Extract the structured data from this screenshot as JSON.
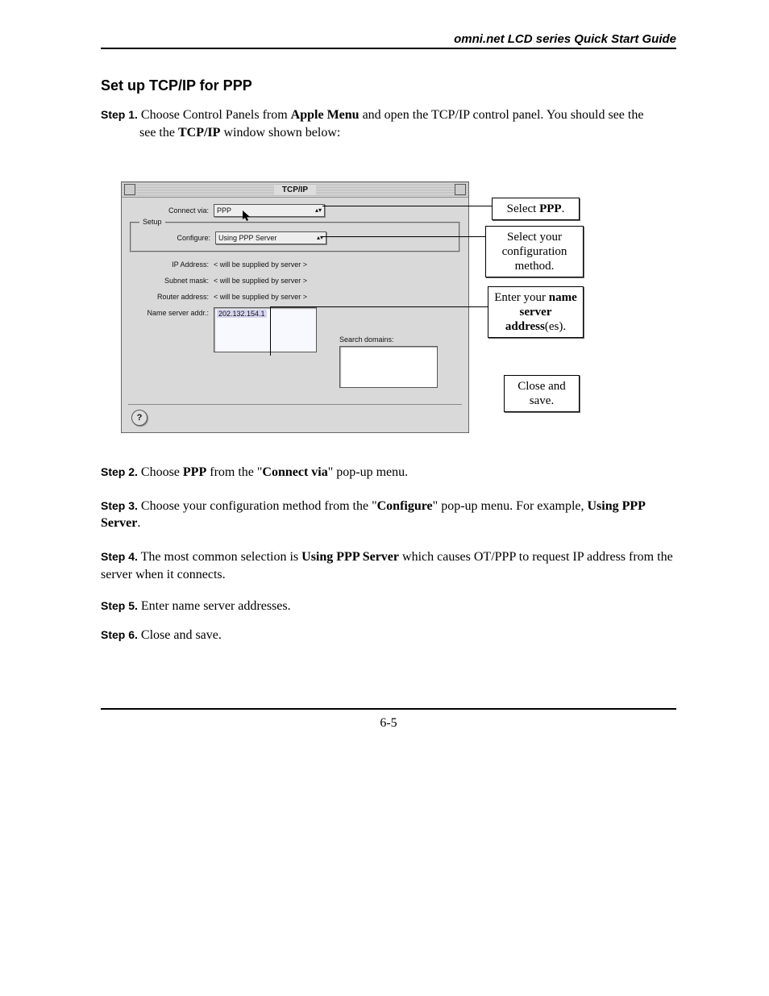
{
  "header": "omni.net LCD series Quick Start Guide",
  "section_title": "Set up TCP/IP for PPP",
  "steps": {
    "s1": {
      "label": "Step 1.",
      "pre": " Choose Control Panels from ",
      "b1": "Apple Menu",
      "mid": " and open the TCP/IP control panel. You should see the ",
      "b2": "TCP/IP",
      "post": " window shown below:"
    },
    "s2": {
      "label": "Step 2.",
      "pre": " Choose ",
      "b1": "PPP",
      "mid": " from the \"",
      "b2": "Connect via",
      "post": "\" pop-up menu."
    },
    "s3": {
      "label": "Step 3.",
      "pre": " Choose your configuration method from the \"",
      "b1": "Configure",
      "mid": "\" pop-up menu. For example, ",
      "b2": "Using PPP Server",
      "post": "."
    },
    "s4": {
      "label": "Step 4.",
      "pre": " The most common selection is ",
      "b1": "Using PPP Server",
      "post": " which causes OT/PPP to request IP address from the server when it connects."
    },
    "s5": {
      "label": "Step 5.",
      "text": " Enter name server addresses."
    },
    "s6": {
      "label": "Step 6.",
      "text": " Close and save."
    }
  },
  "window": {
    "title": "TCP/IP",
    "connect_via_label": "Connect via:",
    "connect_via_value": "PPP",
    "setup_legend": "Setup",
    "configure_label": "Configure:",
    "configure_value": "Using PPP Server",
    "ip_label": "IP Address:",
    "ip_value": "< will be supplied by server >",
    "subnet_label": "Subnet mask:",
    "subnet_value": "< will be supplied by server >",
    "router_label": "Router address:",
    "router_value": "< will be supplied by server >",
    "ns_label": "Name server addr.:",
    "ns_value": "202.132.154.1",
    "search_label": "Search domains:",
    "help": "?"
  },
  "callouts": {
    "c1": {
      "pre": "Select ",
      "b": "PPP",
      "post": "."
    },
    "c2": "Select your configuration method.",
    "c3": {
      "pre": "Enter your ",
      "b1": "name server address",
      "post": "(es)."
    },
    "c4": "Close and save."
  },
  "page_number": "6-5"
}
